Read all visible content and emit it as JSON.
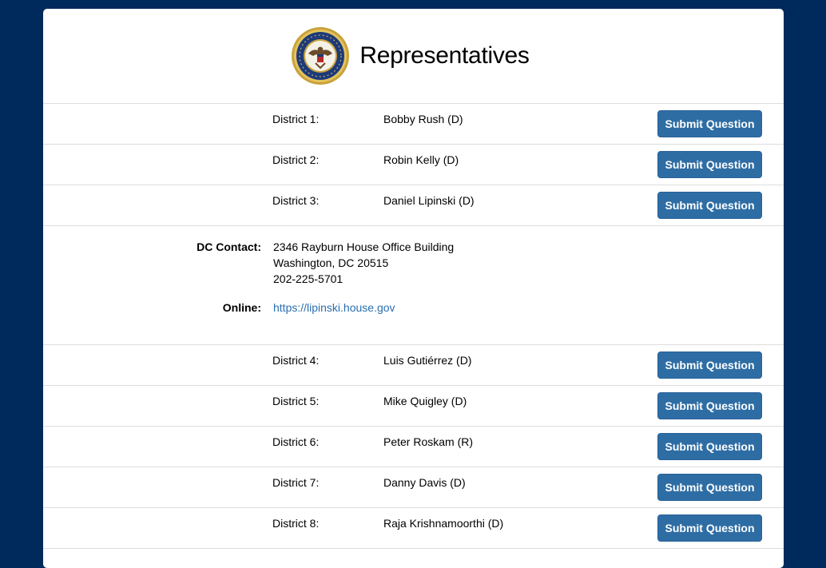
{
  "header": {
    "title": "Representatives"
  },
  "rows_before": [
    {
      "district": "District 1:",
      "name": "Bobby Rush (D)",
      "button": "Submit Question"
    },
    {
      "district": "District 2:",
      "name": "Robin Kelly (D)",
      "button": "Submit Question"
    },
    {
      "district": "District 3:",
      "name": "Daniel Lipinski (D)",
      "button": "Submit Question"
    }
  ],
  "detail": {
    "dc_label": "DC Contact:",
    "address_line1": "2346 Rayburn House Office Building",
    "address_line2": "Washington, DC 20515",
    "phone": "202-225-5701",
    "online_label": "Online:",
    "url": "https://lipinski.house.gov"
  },
  "rows_after": [
    {
      "district": "District 4:",
      "name": "Luis Gutiérrez (D)",
      "button": "Submit Question"
    },
    {
      "district": "District 5:",
      "name": "Mike Quigley (D)",
      "button": "Submit Question"
    },
    {
      "district": "District 6:",
      "name": "Peter Roskam (R)",
      "button": "Submit Question"
    },
    {
      "district": "District 7:",
      "name": "Danny Davis (D)",
      "button": "Submit Question"
    },
    {
      "district": "District 8:",
      "name": "Raja Krishnamoorthi (D)",
      "button": "Submit Question"
    }
  ],
  "colors": {
    "background": "#002a5c",
    "button": "#2e6da4",
    "link": "#2a6fb0"
  },
  "icons": {
    "seal": "house-seal-icon"
  }
}
